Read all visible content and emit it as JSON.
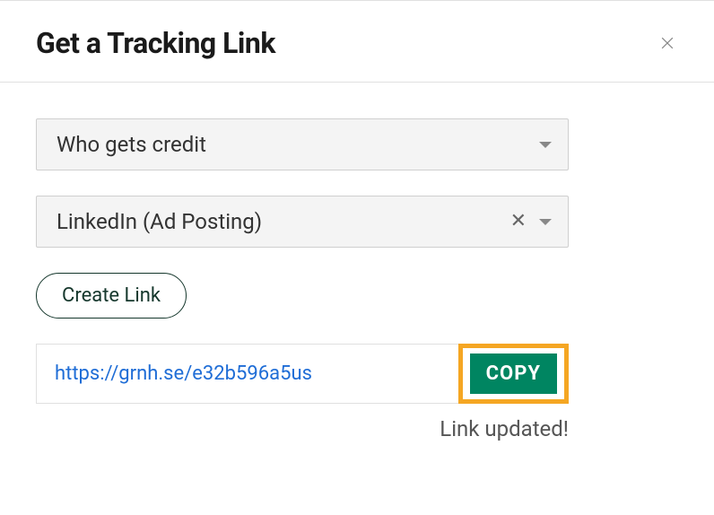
{
  "header": {
    "title": "Get a Tracking Link"
  },
  "form": {
    "credit_select": {
      "placeholder": "Who gets credit"
    },
    "source_select": {
      "value": "LinkedIn (Ad Posting)"
    },
    "create_button_label": "Create Link",
    "link_value": "https://grnh.se/e32b596a5us",
    "copy_button_label": "COPY",
    "status_message": "Link updated!"
  }
}
